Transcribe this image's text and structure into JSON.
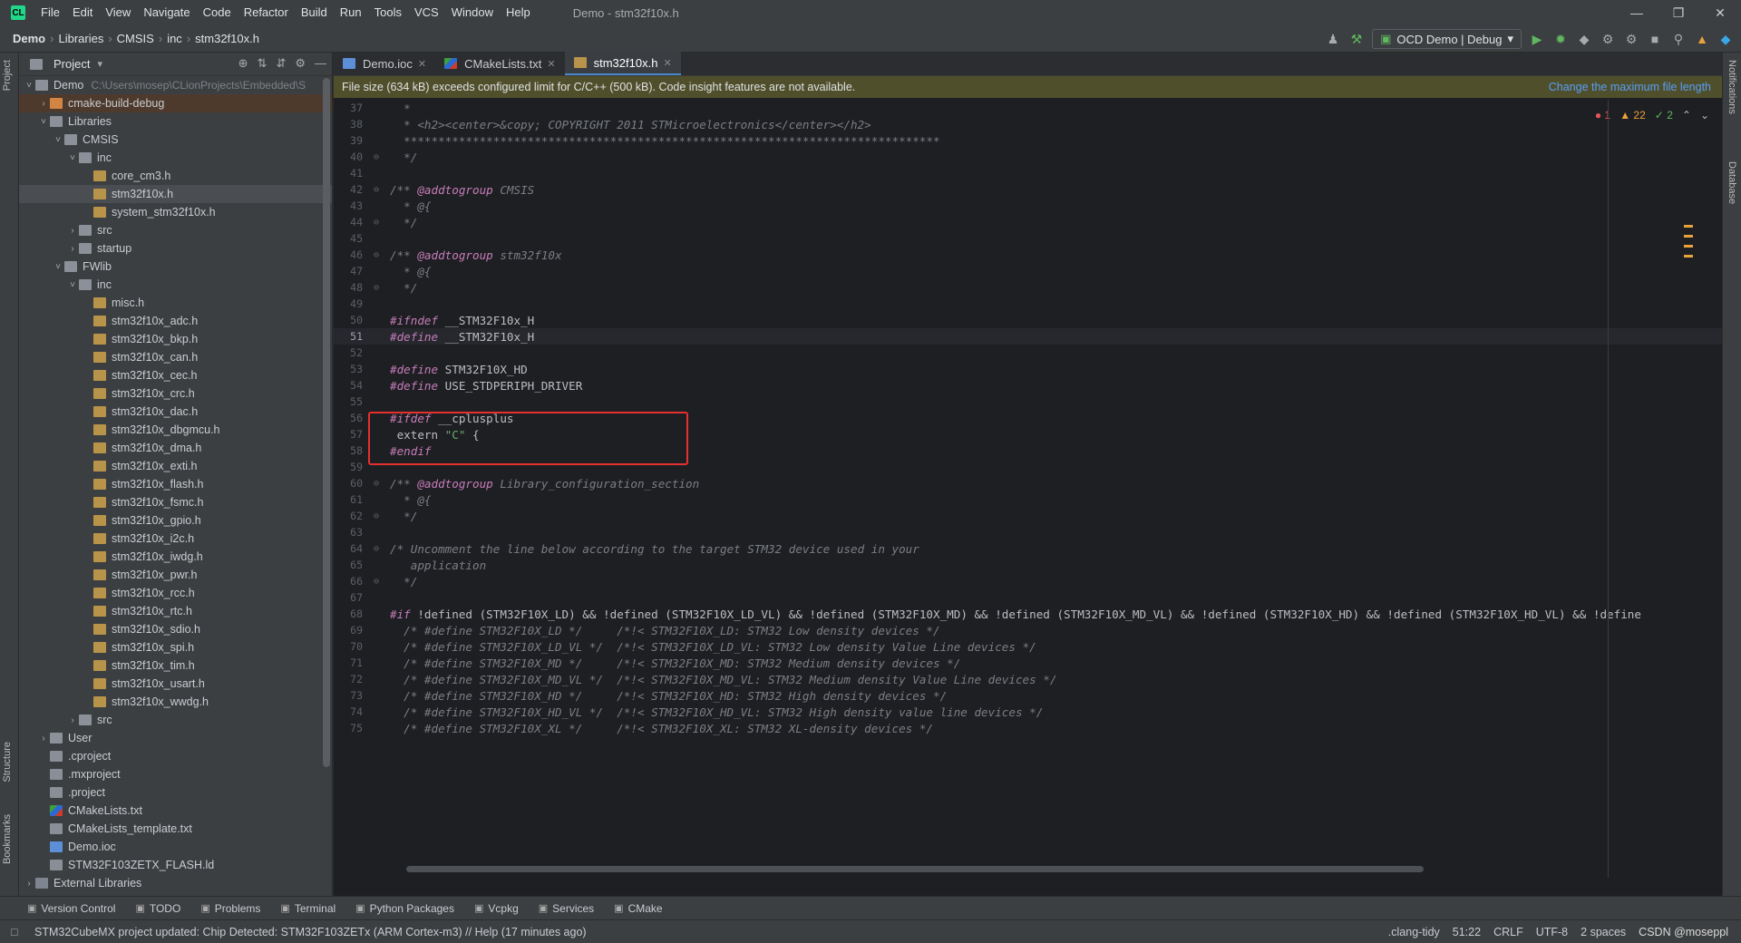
{
  "menubar": {
    "logo": "CL",
    "items": [
      "File",
      "Edit",
      "View",
      "Navigate",
      "Code",
      "Refactor",
      "Build",
      "Run",
      "Tools",
      "VCS",
      "Window",
      "Help"
    ],
    "window_title": "Demo - stm32f10x.h"
  },
  "breadcrumb": [
    "Demo",
    "Libraries",
    "CMSIS",
    "inc",
    "stm32f10x.h"
  ],
  "toolbar": {
    "run_config": "OCD Demo | Debug"
  },
  "left_stripe": {
    "project": "Project",
    "structure": "Structure",
    "bookmarks": "Bookmarks"
  },
  "right_stripe": {
    "notifications": "Notifications",
    "database": "Database"
  },
  "project_panel": {
    "title": "Project",
    "tree": [
      {
        "depth": 0,
        "arrow": "open",
        "icon": "folder",
        "label": "Demo",
        "path": "C:\\Users\\mosep\\CLionProjects\\Embedded\\S"
      },
      {
        "depth": 1,
        "arrow": "closed",
        "icon": "folder-orange",
        "label": "cmake-build-debug",
        "excluded": true
      },
      {
        "depth": 1,
        "arrow": "open",
        "icon": "folder",
        "label": "Libraries"
      },
      {
        "depth": 2,
        "arrow": "open",
        "icon": "folder",
        "label": "CMSIS"
      },
      {
        "depth": 3,
        "arrow": "open",
        "icon": "folder",
        "label": "inc"
      },
      {
        "depth": 4,
        "icon": "hfile",
        "label": "core_cm3.h"
      },
      {
        "depth": 4,
        "icon": "hfile",
        "label": "stm32f10x.h",
        "selected": true
      },
      {
        "depth": 4,
        "icon": "hfile",
        "label": "system_stm32f10x.h"
      },
      {
        "depth": 3,
        "arrow": "closed",
        "icon": "folder",
        "label": "src"
      },
      {
        "depth": 3,
        "arrow": "closed",
        "icon": "folder",
        "label": "startup"
      },
      {
        "depth": 2,
        "arrow": "open",
        "icon": "folder",
        "label": "FWlib"
      },
      {
        "depth": 3,
        "arrow": "open",
        "icon": "folder",
        "label": "inc"
      },
      {
        "depth": 4,
        "icon": "hfile",
        "label": "misc.h"
      },
      {
        "depth": 4,
        "icon": "hfile",
        "label": "stm32f10x_adc.h"
      },
      {
        "depth": 4,
        "icon": "hfile",
        "label": "stm32f10x_bkp.h"
      },
      {
        "depth": 4,
        "icon": "hfile",
        "label": "stm32f10x_can.h"
      },
      {
        "depth": 4,
        "icon": "hfile",
        "label": "stm32f10x_cec.h"
      },
      {
        "depth": 4,
        "icon": "hfile",
        "label": "stm32f10x_crc.h"
      },
      {
        "depth": 4,
        "icon": "hfile",
        "label": "stm32f10x_dac.h"
      },
      {
        "depth": 4,
        "icon": "hfile",
        "label": "stm32f10x_dbgmcu.h"
      },
      {
        "depth": 4,
        "icon": "hfile",
        "label": "stm32f10x_dma.h"
      },
      {
        "depth": 4,
        "icon": "hfile",
        "label": "stm32f10x_exti.h"
      },
      {
        "depth": 4,
        "icon": "hfile",
        "label": "stm32f10x_flash.h"
      },
      {
        "depth": 4,
        "icon": "hfile",
        "label": "stm32f10x_fsmc.h"
      },
      {
        "depth": 4,
        "icon": "hfile",
        "label": "stm32f10x_gpio.h"
      },
      {
        "depth": 4,
        "icon": "hfile",
        "label": "stm32f10x_i2c.h"
      },
      {
        "depth": 4,
        "icon": "hfile",
        "label": "stm32f10x_iwdg.h"
      },
      {
        "depth": 4,
        "icon": "hfile",
        "label": "stm32f10x_pwr.h"
      },
      {
        "depth": 4,
        "icon": "hfile",
        "label": "stm32f10x_rcc.h"
      },
      {
        "depth": 4,
        "icon": "hfile",
        "label": "stm32f10x_rtc.h"
      },
      {
        "depth": 4,
        "icon": "hfile",
        "label": "stm32f10x_sdio.h"
      },
      {
        "depth": 4,
        "icon": "hfile",
        "label": "stm32f10x_spi.h"
      },
      {
        "depth": 4,
        "icon": "hfile",
        "label": "stm32f10x_tim.h"
      },
      {
        "depth": 4,
        "icon": "hfile",
        "label": "stm32f10x_usart.h"
      },
      {
        "depth": 4,
        "icon": "hfile",
        "label": "stm32f10x_wwdg.h"
      },
      {
        "depth": 3,
        "arrow": "closed",
        "icon": "folder",
        "label": "src"
      },
      {
        "depth": 1,
        "arrow": "closed",
        "icon": "folder",
        "label": "User"
      },
      {
        "depth": 1,
        "icon": "plain",
        "label": ".cproject"
      },
      {
        "depth": 1,
        "icon": "plain",
        "label": ".mxproject"
      },
      {
        "depth": 1,
        "icon": "plain",
        "label": ".project"
      },
      {
        "depth": 1,
        "icon": "cmake",
        "label": "CMakeLists.txt"
      },
      {
        "depth": 1,
        "icon": "plain",
        "label": "CMakeLists_template.txt"
      },
      {
        "depth": 1,
        "icon": "ioc",
        "label": "Demo.ioc"
      },
      {
        "depth": 1,
        "icon": "plain",
        "label": "STM32F103ZETX_FLASH.ld"
      },
      {
        "depth": 0,
        "arrow": "closed",
        "icon": "lib",
        "label": "External Libraries"
      }
    ]
  },
  "editor": {
    "tabs": [
      {
        "label": "Demo.ioc",
        "icon": "ioc",
        "active": false
      },
      {
        "label": "CMakeLists.txt",
        "icon": "cmake",
        "active": false
      },
      {
        "label": "stm32f10x.h",
        "icon": "hfile",
        "active": true
      }
    ],
    "banner": {
      "message": "File size (634 kB) exceeds configured limit for C/C++ (500 kB). Code insight features are not available.",
      "link": "Change the maximum file length"
    },
    "inspection": {
      "errors": "1",
      "warnings": "22",
      "ok": "2"
    },
    "current_line": 51,
    "lines": [
      {
        "n": 37,
        "segs": [
          [
            "cmt",
            "  *"
          ]
        ]
      },
      {
        "n": 38,
        "segs": [
          [
            "cmt",
            "  * <h2><center>&copy; COPYRIGHT 2011 STMicroelectronics</center></h2>"
          ]
        ]
      },
      {
        "n": 39,
        "segs": [
          [
            "cmt",
            "  ******************************************************************************"
          ]
        ]
      },
      {
        "n": 40,
        "fold": "end",
        "segs": [
          [
            "cmt",
            "  */"
          ]
        ]
      },
      {
        "n": 41,
        "segs": []
      },
      {
        "n": 42,
        "fold": "start",
        "segs": [
          [
            "cmt",
            "/** "
          ],
          [
            "doctag",
            "@addtogroup"
          ],
          [
            "cmt",
            " CMSIS"
          ]
        ]
      },
      {
        "n": 43,
        "segs": [
          [
            "cmt",
            "  * @{"
          ]
        ]
      },
      {
        "n": 44,
        "fold": "end",
        "segs": [
          [
            "cmt",
            "  */"
          ]
        ]
      },
      {
        "n": 45,
        "segs": []
      },
      {
        "n": 46,
        "fold": "start",
        "segs": [
          [
            "cmt",
            "/** "
          ],
          [
            "doctag",
            "@addtogroup"
          ],
          [
            "cmt",
            " stm32f10x"
          ]
        ]
      },
      {
        "n": 47,
        "segs": [
          [
            "cmt",
            "  * @{"
          ]
        ]
      },
      {
        "n": 48,
        "fold": "end",
        "segs": [
          [
            "cmt",
            "  */"
          ]
        ]
      },
      {
        "n": 49,
        "segs": []
      },
      {
        "n": 50,
        "segs": [
          [
            "pp",
            "#ifndef"
          ],
          [
            "txt",
            " __STM32F10x_H"
          ]
        ]
      },
      {
        "n": 51,
        "segs": [
          [
            "pp",
            "#define"
          ],
          [
            "txt",
            " __STM32F10x_H"
          ]
        ]
      },
      {
        "n": 52,
        "segs": []
      },
      {
        "n": 53,
        "segs": [
          [
            "pp",
            "#define"
          ],
          [
            "txt",
            " STM32F10X_HD"
          ]
        ]
      },
      {
        "n": 54,
        "segs": [
          [
            "pp",
            "#define"
          ],
          [
            "txt",
            " USE_STDPERIPH_DRIVER"
          ]
        ]
      },
      {
        "n": 55,
        "segs": []
      },
      {
        "n": 56,
        "segs": [
          [
            "pp",
            "#ifdef"
          ],
          [
            "txt",
            " __cplusplus"
          ]
        ]
      },
      {
        "n": 57,
        "segs": [
          [
            "txt",
            " extern "
          ],
          [
            "str",
            "\"C\""
          ],
          [
            "txt",
            " {"
          ]
        ]
      },
      {
        "n": 58,
        "segs": [
          [
            "pp",
            "#endif"
          ]
        ]
      },
      {
        "n": 59,
        "segs": []
      },
      {
        "n": 60,
        "fold": "start",
        "segs": [
          [
            "cmt",
            "/** "
          ],
          [
            "doctag",
            "@addtogroup"
          ],
          [
            "cmt",
            " Library_configuration_section"
          ]
        ]
      },
      {
        "n": 61,
        "segs": [
          [
            "cmt",
            "  * @{"
          ]
        ]
      },
      {
        "n": 62,
        "fold": "end",
        "segs": [
          [
            "cmt",
            "  */"
          ]
        ]
      },
      {
        "n": 63,
        "segs": []
      },
      {
        "n": 64,
        "fold": "start",
        "segs": [
          [
            "cmt",
            "/* Uncomment the line below according to the target STM32 device used in your"
          ]
        ]
      },
      {
        "n": 65,
        "segs": [
          [
            "cmt",
            "   application"
          ]
        ]
      },
      {
        "n": 66,
        "fold": "end",
        "segs": [
          [
            "cmt",
            "  */"
          ]
        ]
      },
      {
        "n": 67,
        "segs": []
      },
      {
        "n": 68,
        "segs": [
          [
            "pp",
            "#if"
          ],
          [
            "txt",
            " !defined (STM32F10X_LD) && !defined (STM32F10X_LD_VL) && !defined (STM32F10X_MD) && !defined (STM32F10X_MD_VL) && !defined (STM32F10X_HD) && !defined (STM32F10X_HD_VL) && !define"
          ]
        ]
      },
      {
        "n": 69,
        "segs": [
          [
            "cmt",
            "  /* #define STM32F10X_LD */     /*!< STM32F10X_LD: STM32 Low density devices */"
          ]
        ]
      },
      {
        "n": 70,
        "segs": [
          [
            "cmt",
            "  /* #define STM32F10X_LD_VL */  /*!< STM32F10X_LD_VL: STM32 Low density Value Line devices */"
          ]
        ]
      },
      {
        "n": 71,
        "segs": [
          [
            "cmt",
            "  /* #define STM32F10X_MD */     /*!< STM32F10X_MD: STM32 Medium density devices */"
          ]
        ]
      },
      {
        "n": 72,
        "segs": [
          [
            "cmt",
            "  /* #define STM32F10X_MD_VL */  /*!< STM32F10X_MD_VL: STM32 Medium density Value Line devices */"
          ]
        ]
      },
      {
        "n": 73,
        "segs": [
          [
            "cmt",
            "  /* #define STM32F10X_HD */     /*!< STM32F10X_HD: STM32 High density devices */"
          ]
        ]
      },
      {
        "n": 74,
        "segs": [
          [
            "cmt",
            "  /* #define STM32F10X_HD_VL */  /*!< STM32F10X_HD_VL: STM32 High density value line devices */"
          ]
        ]
      },
      {
        "n": 75,
        "segs": [
          [
            "cmt",
            "  /* #define STM32F10X_XL */     /*!< STM32F10X_XL: STM32 XL-density devices */"
          ]
        ]
      }
    ]
  },
  "tool_windows": [
    {
      "label": "Version Control",
      "icon": "vcs-icon"
    },
    {
      "label": "TODO",
      "icon": "todo-icon"
    },
    {
      "label": "Problems",
      "icon": "problems-icon"
    },
    {
      "label": "Terminal",
      "icon": "terminal-icon"
    },
    {
      "label": "Python Packages",
      "icon": "packages-icon"
    },
    {
      "label": "Vcpkg",
      "icon": "vcpkg-icon"
    },
    {
      "label": "Services",
      "icon": "services-icon"
    },
    {
      "label": "CMake",
      "icon": "cmake-icon"
    }
  ],
  "status": {
    "message": "STM32CubeMX project updated: Chip Detected: STM32F103ZETx (ARM Cortex-m3) // Help (17 minutes ago)",
    "clang_tidy": ".clang-tidy",
    "position": "51:22",
    "line_sep": "CRLF",
    "encoding": "UTF-8",
    "indent": "2 spaces",
    "watermark": "CSDN @moseppl"
  }
}
